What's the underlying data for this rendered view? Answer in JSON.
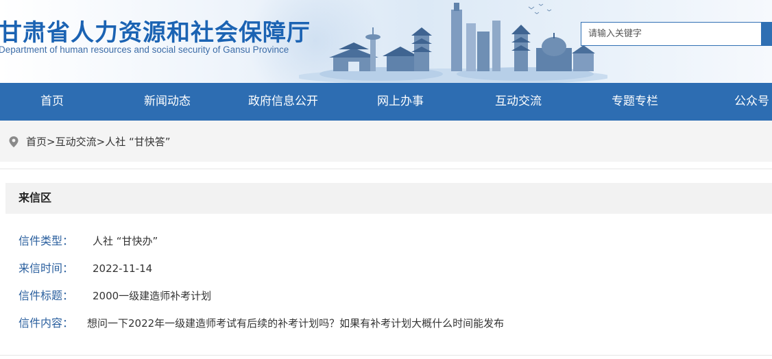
{
  "header": {
    "title": "甘肃省人力资源和社会保障厅",
    "subtitle": "Department of human resources and social security of Gansu Province",
    "search": {
      "placeholder": "请输入关键字"
    }
  },
  "nav": {
    "items": [
      {
        "label": "首页"
      },
      {
        "label": "新闻动态"
      },
      {
        "label": "政府信息公开"
      },
      {
        "label": "网上办事"
      },
      {
        "label": "互动交流"
      },
      {
        "label": "专题专栏"
      },
      {
        "label": "公众号"
      }
    ]
  },
  "breadcrumb": {
    "items": [
      {
        "label": "首页"
      },
      {
        "label": "互动交流"
      },
      {
        "label": "人社 “甘快答”"
      }
    ],
    "separator": ">"
  },
  "letter": {
    "section_title": "来信区",
    "fields": [
      {
        "label": "信件类型：",
        "value": "人社 “甘快办”"
      },
      {
        "label": "来信时间：",
        "value": "2022-11-14"
      },
      {
        "label": "信件标题：",
        "value": "2000一级建造师补考计划"
      },
      {
        "label": "信件内容：",
        "value": "想问一下2022年一级建造师考试有后续的补考计划吗？如果有补考计划大概什么时间能发布"
      }
    ]
  },
  "colors": {
    "nav_bg": "#2d6db2",
    "title_blue": "#1b63b3",
    "label_blue": "#2a5f9e"
  }
}
